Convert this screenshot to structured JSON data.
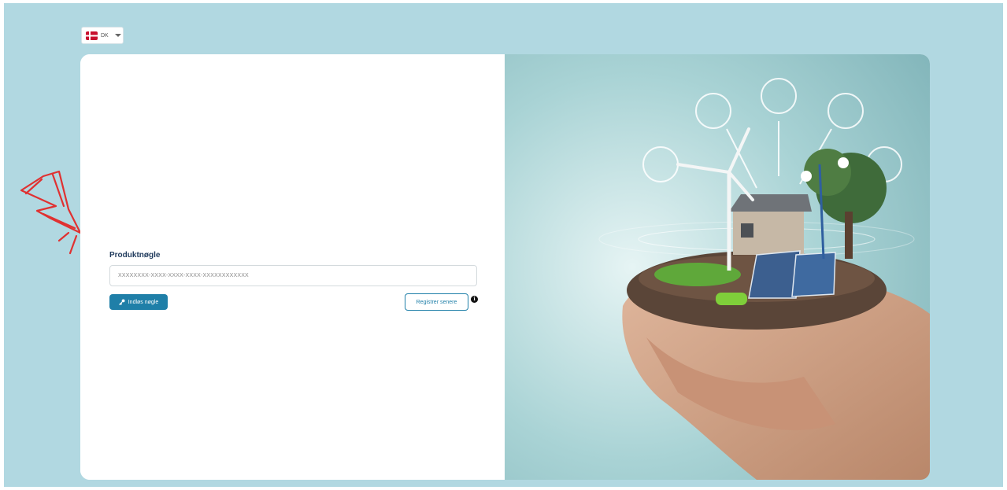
{
  "language_selector": {
    "code": "DK"
  },
  "form": {
    "label": "Produktnøgle",
    "input_placeholder": "XXXXXXXX-XXXX-XXXX-XXXX-XXXXXXXXXXXX",
    "submit_label": "Indløs nøgle",
    "later_label": "Registrer senere",
    "info_glyph": "i"
  },
  "icons": {
    "flag": "denmark-flag-icon",
    "key": "key-icon",
    "info": "info-icon",
    "arrow": "hand-drawn-arrow-icon"
  },
  "colors": {
    "background": "#b1d8e1",
    "primary": "#1f7fa8",
    "label": "#1f3a5c",
    "annotation": "#e03131"
  }
}
